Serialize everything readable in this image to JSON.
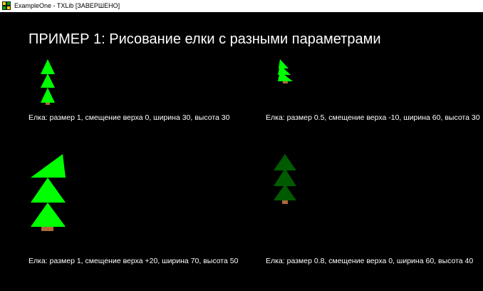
{
  "window": {
    "title": "ExampleOne - TXLib [ЗАВЕРШЕНО]",
    "icon": "txlib-app-icon"
  },
  "heading": "ПРИМЕР 1: Рисование елки с разными параметрами",
  "colors": {
    "background": "#000000",
    "text": "#ffffff",
    "tree_bright": "#00ff00",
    "tree_dark": "#005a00",
    "trunk": "#b0663a"
  },
  "trees": [
    {
      "caption": "Елка: размер 1, смещение верха 0, ширина 30, высота 30",
      "size": 1,
      "top_shift": 0,
      "width": 30,
      "height": 30,
      "color": "#00ff00"
    },
    {
      "caption": "Елка: размер 0.5, смещение верха -10, ширина 60, высота 30",
      "size": 0.5,
      "top_shift": -10,
      "width": 60,
      "height": 30,
      "color": "#00ff00"
    },
    {
      "caption": "Елка: размер 1, смещение верха +20, ширина 70, высота 50",
      "size": 1,
      "top_shift": 20,
      "width": 70,
      "height": 50,
      "color": "#00ff00"
    },
    {
      "caption": "Елка: размер 0.8, смещение верха 0, ширина 60, высота 40",
      "size": 0.8,
      "top_shift": 0,
      "width": 60,
      "height": 40,
      "color": "#005a00"
    }
  ]
}
